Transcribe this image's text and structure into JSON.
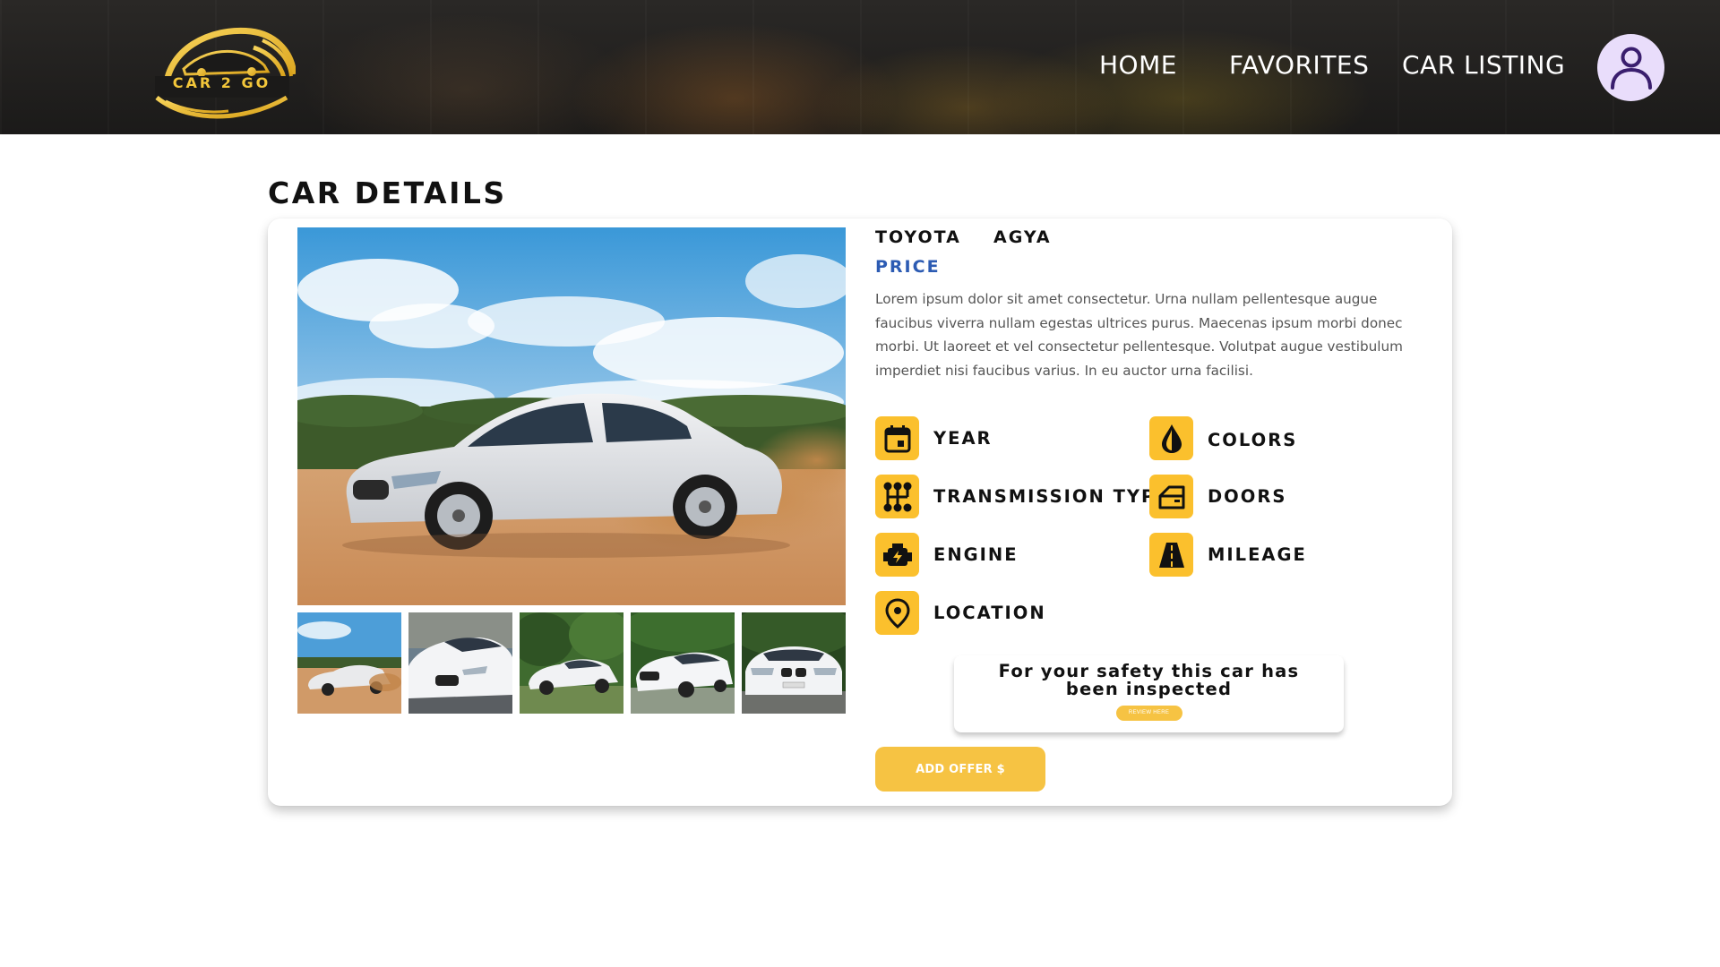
{
  "header": {
    "logo_text": "CAR 2 GO",
    "nav": {
      "home": "HOME",
      "favorites": "FAVORITES",
      "car_listing": "CAR LISTING"
    },
    "avatar_icon": "user-icon"
  },
  "page": {
    "title": "CAR DETAILS"
  },
  "car": {
    "make": "TOYOTA",
    "model": "AGYA",
    "price_label": "PRICE",
    "description": "Lorem ipsum dolor sit amet consectetur. Urna nullam pellentesque augue faucibus viverra nullam egestas ultrices purus. Maecenas ipsum morbi donec morbi. Ut laoreet et vel consectetur pellentesque. Volutpat augue vestibulum imperdiet nisi faucibus varius. In eu auctor urna facilisi.",
    "gallery_count": 5
  },
  "specs": {
    "year": {
      "label": "YEAR",
      "icon": "calendar-icon"
    },
    "colors": {
      "label": "COLORS",
      "icon": "drop-icon"
    },
    "transmission": {
      "label": "TRANSMISSION TYPE",
      "icon": "gearbox-icon"
    },
    "doors": {
      "label": "DOORS",
      "icon": "car-door-icon"
    },
    "engine": {
      "label": "ENGINE",
      "icon": "engine-icon"
    },
    "mileage": {
      "label": "MILEAGE",
      "icon": "road-icon"
    },
    "location": {
      "label": "LOCATION",
      "icon": "location-pin-icon"
    }
  },
  "safety": {
    "text": "For your safety this car has been inspected",
    "review_button": "REVIEW HERE"
  },
  "actions": {
    "add_offer": "ADD OFFER $"
  },
  "colors": {
    "accent": "#fbc02d",
    "button": "#f6c343",
    "price": "#2c5bb3",
    "avatar_bg": "#e9ddfb",
    "avatar_icon": "#3a1e6e"
  }
}
